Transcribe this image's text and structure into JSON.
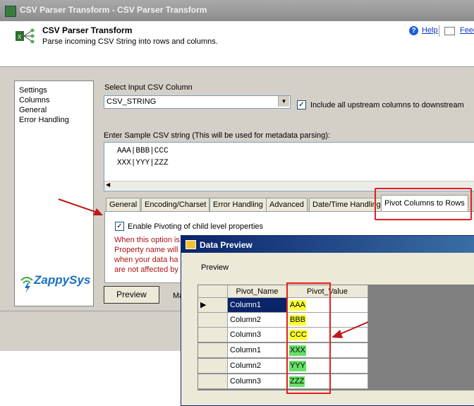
{
  "window": {
    "title": "CSV Parser Transform - CSV Parser Transform"
  },
  "header": {
    "title": "CSV Parser Transform",
    "description": "Parse incoming CSV String into rows and columns.",
    "help_label": "Help",
    "feedback_label": "Feedback"
  },
  "nav": {
    "items": [
      "Settings",
      "Columns",
      "General",
      "Error Handling"
    ]
  },
  "logo": {
    "text": "ZappySys"
  },
  "form": {
    "select_label": "Select Input CSV Column",
    "select_value": "CSV_STRING",
    "include_upstream_label": "Include all upstream columns to downstream",
    "include_upstream_checked": true,
    "sample_label": "Enter Sample CSV string (This will be used for metadata parsing):",
    "sample_lines": [
      "AAA|BBB|CCC",
      "XXX|YYY|ZZZ"
    ]
  },
  "tabs": [
    "General",
    "Encoding/Charset",
    "Error Handling",
    "Advanced",
    "Date/Time Handling",
    "Pivot Columns to Rows"
  ],
  "active_tab": "Pivot Columns to Rows",
  "pivot_panel": {
    "enable_label": "Enable Pivoting of child level properties",
    "enable_checked": true,
    "notes": [
      "When this option is",
      "Property name will",
      "when your data ha",
      "are not affected by"
    ]
  },
  "buttons": {
    "preview": "Preview",
    "max_rows_label_partial": "Ma"
  },
  "preview_dialog": {
    "title": "Data Preview",
    "section_label": "Preview",
    "columns": [
      "Pivot_Name",
      "Pivot_Value"
    ],
    "rows": [
      {
        "name": "Column1",
        "value": "AAA",
        "color": "#ffff33"
      },
      {
        "name": "Column2",
        "value": "BBB",
        "color": "#ffff33"
      },
      {
        "name": "Column3",
        "value": "CCC",
        "color": "#ffff33"
      },
      {
        "name": "Column1",
        "value": "XXX",
        "color": "#66e066"
      },
      {
        "name": "Column2",
        "value": "YYY",
        "color": "#66e066"
      },
      {
        "name": "Column3",
        "value": "ZZZ",
        "color": "#66e066"
      }
    ],
    "selected_row": 0
  },
  "colors": {
    "annotation_red": "#e02020",
    "title_blue": "#0a246a"
  }
}
